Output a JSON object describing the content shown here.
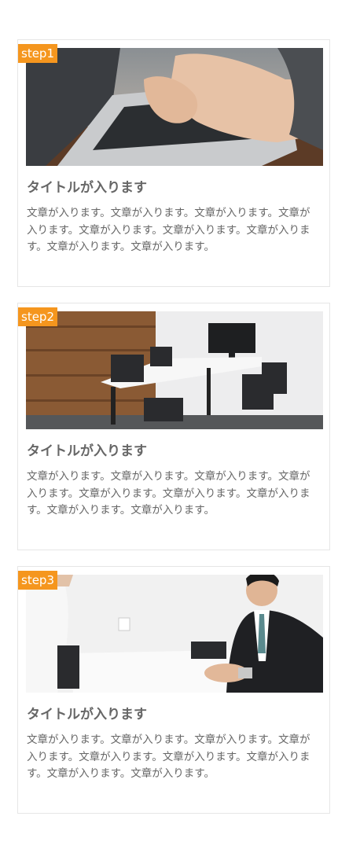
{
  "steps": [
    {
      "badge": "step1",
      "title": "タイトルが入ります",
      "text": "文章が入ります。文章が入ります。文章が入ります。文章が入ります。文章が入ります。文章が入ります。文章が入ります。文章が入ります。文章が入ります。",
      "photo_icon": "laptop-typing-photo"
    },
    {
      "badge": "step2",
      "title": "タイトルが入ります",
      "text": "文章が入ります。文章が入ります。文章が入ります。文章が入ります。文章が入ります。文章が入ります。文章が入ります。文章が入ります。文章が入ります。",
      "photo_icon": "meeting-room-photo"
    },
    {
      "badge": "step3",
      "title": "タイトルが入ります",
      "text": "文章が入ります。文章が入ります。文章が入ります。文章が入ります。文章が入ります。文章が入ります。文章が入ります。文章が入ります。文章が入ります。",
      "photo_icon": "interview-photo"
    }
  ],
  "colors": {
    "badge_bg": "#f5961e",
    "text": "#666666",
    "border": "#e6e6e6"
  }
}
